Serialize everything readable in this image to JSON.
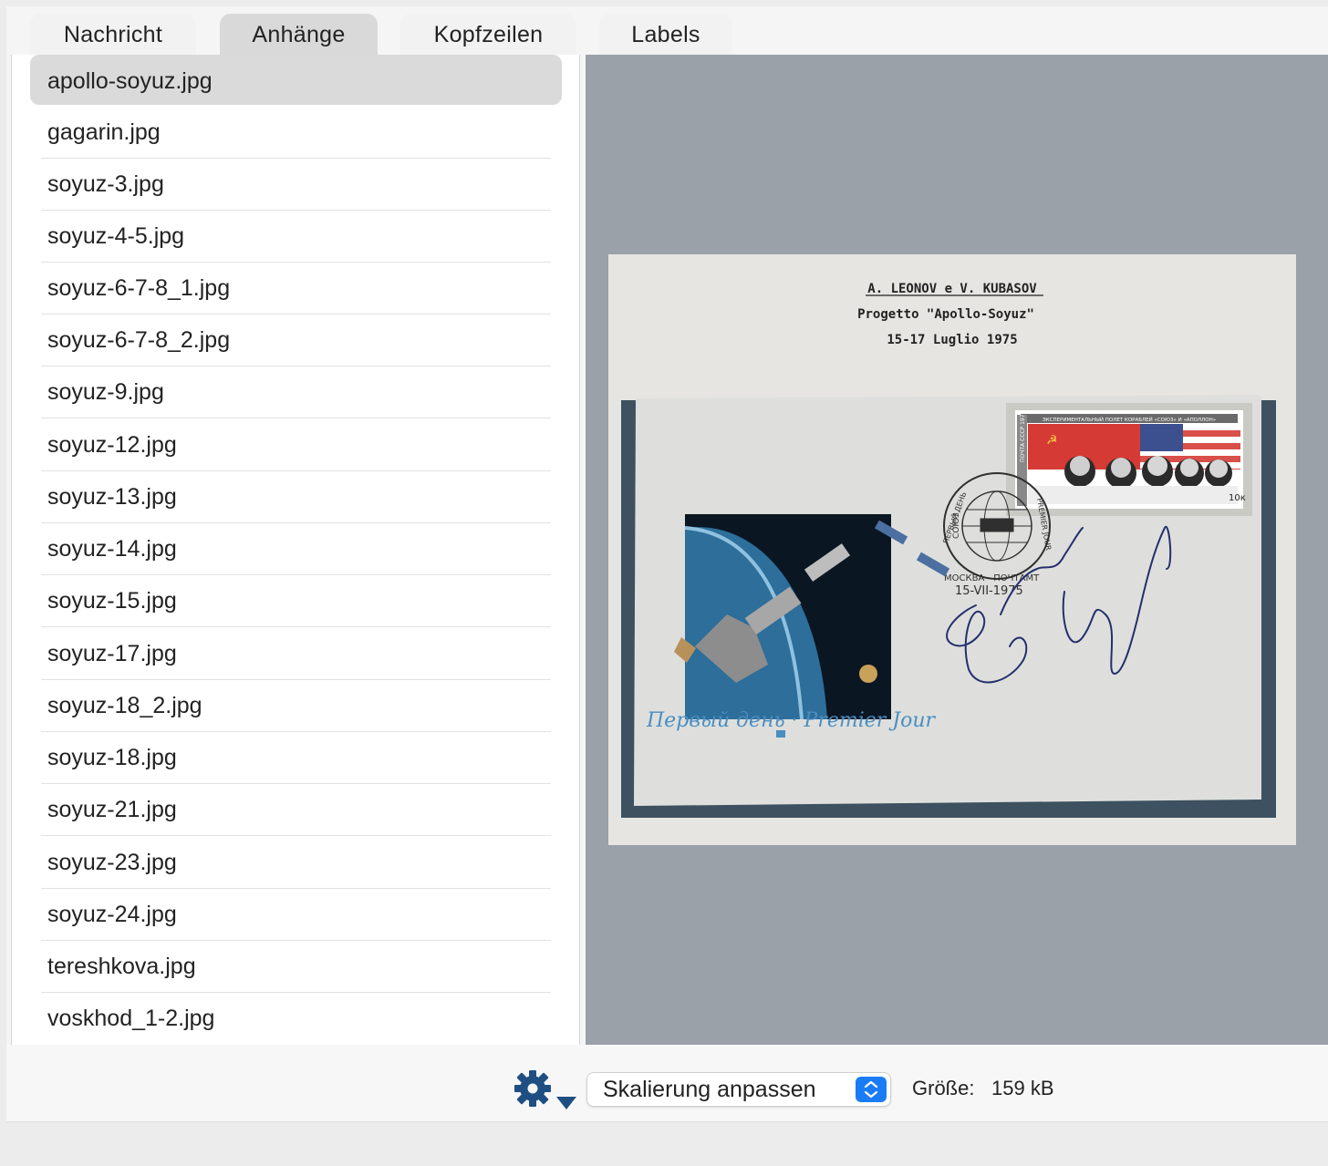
{
  "tabs": [
    {
      "label": "Nachricht"
    },
    {
      "label": "Anhänge"
    },
    {
      "label": "Kopfzeilen"
    },
    {
      "label": "Labels"
    }
  ],
  "attachments": [
    "apollo-soyuz.jpg",
    "gagarin.jpg",
    "soyuz-3.jpg",
    "soyuz-4-5.jpg",
    "soyuz-6-7-8_1.jpg",
    "soyuz-6-7-8_2.jpg",
    "soyuz-9.jpg",
    "soyuz-12.jpg",
    "soyuz-13.jpg",
    "soyuz-14.jpg",
    "soyuz-15.jpg",
    "soyuz-17.jpg",
    "soyuz-18_2.jpg",
    "soyuz-18.jpg",
    "soyuz-21.jpg",
    "soyuz-23.jpg",
    "soyuz-24.jpg",
    "tereshkova.jpg",
    "voskhod_1-2.jpg"
  ],
  "selected_attachment": "apollo-soyuz.jpg",
  "preview": {
    "caption_line1": "A. LEONOV e V. KUBASOV",
    "caption_line2": "Progetto \"Apollo-Soyuz\"",
    "caption_line3": "15-17 Luglio 1975",
    "postmark_city": "МОСКВА - ПОЧТАМТ",
    "postmark_date": "15-VII-1975",
    "stamp_header": "ЭКСПЕРИМЕНТАЛЬНЫЙ ПОЛЕТ КОРАБЛЕЙ «СОЮЗ» И «АПОЛЛОН»",
    "stamp_country": "ПОЧТА СССР 1975",
    "stamp_value": "10к",
    "envelope_script": "Первый день · Premier Jour",
    "postmark_side": "ПЕРВЫЙ ДЕНЬ",
    "postmark_side2": "PREMIER JOUR",
    "postmark_emblem": "СОЮЗ"
  },
  "toolbar": {
    "gear_icon": "gear-icon",
    "scale_select": "Skalierung anpassen",
    "size_label": "Größe:",
    "size_value": "159 kB"
  },
  "colors": {
    "accent": "#1a7cf5",
    "gear": "#1f4f82",
    "preview_bg": "#9ba1a8",
    "selection": "#dadada"
  }
}
